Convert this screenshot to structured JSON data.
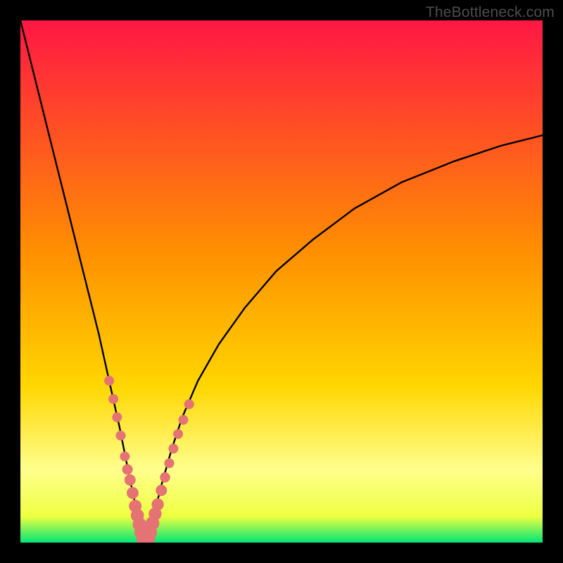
{
  "watermark": "TheBottleneck.com",
  "colors": {
    "frame": "#000000",
    "grad_top": "#ff1744",
    "grad_mid": "#ffd600",
    "grad_band": "#ffff8d",
    "grad_bottom": "#00e676",
    "curve": "#000000",
    "marker": "#e57373"
  },
  "chart_data": {
    "type": "line",
    "title": "",
    "xlabel": "",
    "ylabel": "",
    "xlim": [
      0,
      100
    ],
    "ylim": [
      0,
      100
    ],
    "grid": false,
    "note": "V-shaped bottleneck curve. y ≈ 100 at x=0, drops to 0 near x≈24 (apex), rises back toward ~78 at x=100. No numeric tick labels are shown; values are estimated from pixel positions relative to the plot box.",
    "apex_x": 24,
    "series": [
      {
        "name": "bottleneck-curve",
        "x": [
          0,
          3,
          6,
          9,
          12,
          15,
          17,
          19,
          21,
          22.5,
          24,
          25.5,
          27,
          29,
          31,
          34,
          38,
          43,
          49,
          56,
          64,
          73,
          83,
          92,
          100
        ],
        "y": [
          100,
          88,
          76,
          64,
          52,
          40,
          31,
          22,
          12,
          5,
          0,
          5,
          11,
          18,
          24,
          31,
          38,
          45,
          52,
          58,
          64,
          69,
          73,
          76,
          78
        ]
      }
    ],
    "markers": {
      "name": "highlight-points",
      "note": "Clustered pink markers around the apex on both arms of the V.",
      "x": [
        17,
        17.8,
        18.5,
        19.2,
        20,
        20.5,
        21,
        21.5,
        22,
        22.4,
        22.8,
        23.2,
        23.6,
        24,
        24.4,
        24.8,
        25.3,
        25.8,
        26.3,
        27,
        27.7,
        28.5,
        29.3,
        30.2,
        31.2,
        32.3
      ],
      "y": [
        31,
        27.5,
        24,
        20.5,
        16.5,
        14,
        12,
        9.5,
        7,
        5.2,
        3.5,
        2,
        0.8,
        0,
        0.8,
        2,
        3.7,
        5.5,
        7.3,
        10,
        12.5,
        15.2,
        18,
        20.8,
        23.5,
        26.5
      ]
    }
  }
}
